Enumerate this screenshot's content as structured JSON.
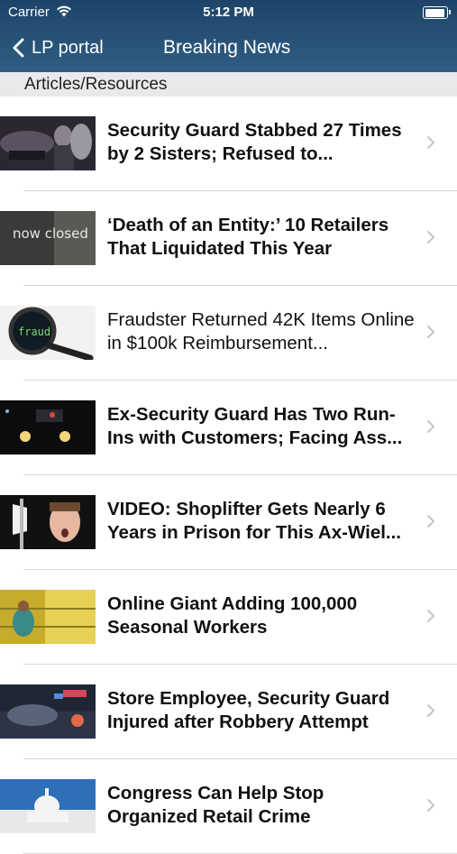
{
  "status_bar": {
    "carrier": "Carrier",
    "time": "5:12 PM"
  },
  "nav": {
    "back_label": "LP portal",
    "title": "Breaking News"
  },
  "section": {
    "title": "Articles/Resources"
  },
  "articles": [
    {
      "title": "Security Guard Stabbed 27 Times by 2 Sisters; Refused to...",
      "bold": true,
      "thumb_text": ""
    },
    {
      "title": "‘Death of an Entity:’ 10 Retailers That Liquidated This Year",
      "bold": true,
      "thumb_text": "now closed"
    },
    {
      "title": "Fraudster Returned 42K Items Online in $100k Reimbursement...",
      "bold": false,
      "thumb_text": "fraud"
    },
    {
      "title": "Ex-Security Guard Has Two Run-Ins with Customers; Facing Ass...",
      "bold": true,
      "thumb_text": ""
    },
    {
      "title": "VIDEO: Shoplifter Gets Nearly 6 Years in Prison for This Ax-Wiel...",
      "bold": true,
      "thumb_text": ""
    },
    {
      "title": "Online Giant Adding 100,000 Seasonal Workers",
      "bold": true,
      "thumb_text": ""
    },
    {
      "title": "Store Employee, Security Guard Injured after Robbery Attempt",
      "bold": true,
      "thumb_text": ""
    },
    {
      "title": "Congress Can Help Stop Organized Retail Crime",
      "bold": true,
      "thumb_text": ""
    }
  ]
}
